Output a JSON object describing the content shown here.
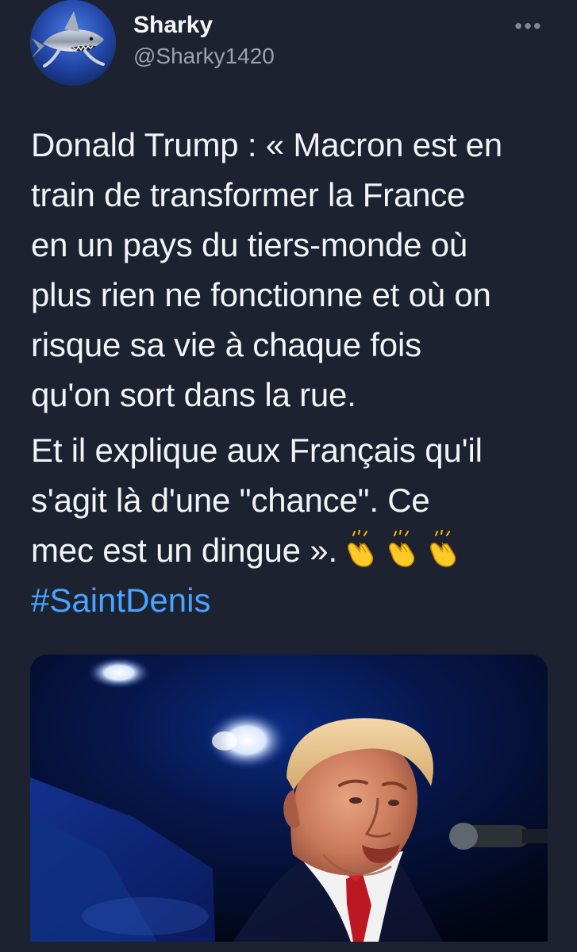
{
  "user": {
    "display_name": "Sharky",
    "handle": "@Sharky1420",
    "avatar_icon": "shark-avatar-icon"
  },
  "tweet": {
    "paragraph_1": "Donald Trump : « Macron est en\ntrain de transformer la France\nen un pays du tiers-monde où\nplus rien ne fonctionne et où on\nrisque sa vie à chaque fois\nqu'on sort dans la rue.",
    "paragraph_2": "Et il explique aux Français qu'il\ns'agit là d'une \"chance\". Ce\nmec est un dingue ».",
    "emoji_icon": "clapping-hands-icon",
    "emoji_count": 3,
    "hashtag": "#SaintDenis"
  },
  "colors": {
    "background": "#1c2230",
    "text": "#f2f4f7",
    "secondary_text": "#9aa3ae",
    "hashtag": "#4aa3ff",
    "photo_background": "#050a22"
  },
  "menu": {
    "more_icon": "more-options-icon"
  },
  "media": {
    "type": "photo"
  }
}
